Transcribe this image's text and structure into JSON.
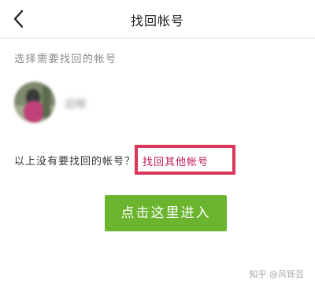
{
  "header": {
    "title": "找回帐号",
    "back_icon": "chevron-left-icon"
  },
  "section_label": "选择需要找回的帐号",
  "account": {
    "name": "迎晰"
  },
  "other_accounts": {
    "prompt": "以上没有要找回的帐号？",
    "link_label": "找回其他帐号",
    "highlight_color": "#d9365a"
  },
  "enter_button": {
    "label": "点击这里进入",
    "color": "#6ab42e"
  },
  "watermark": "知乎 @风铄芸"
}
